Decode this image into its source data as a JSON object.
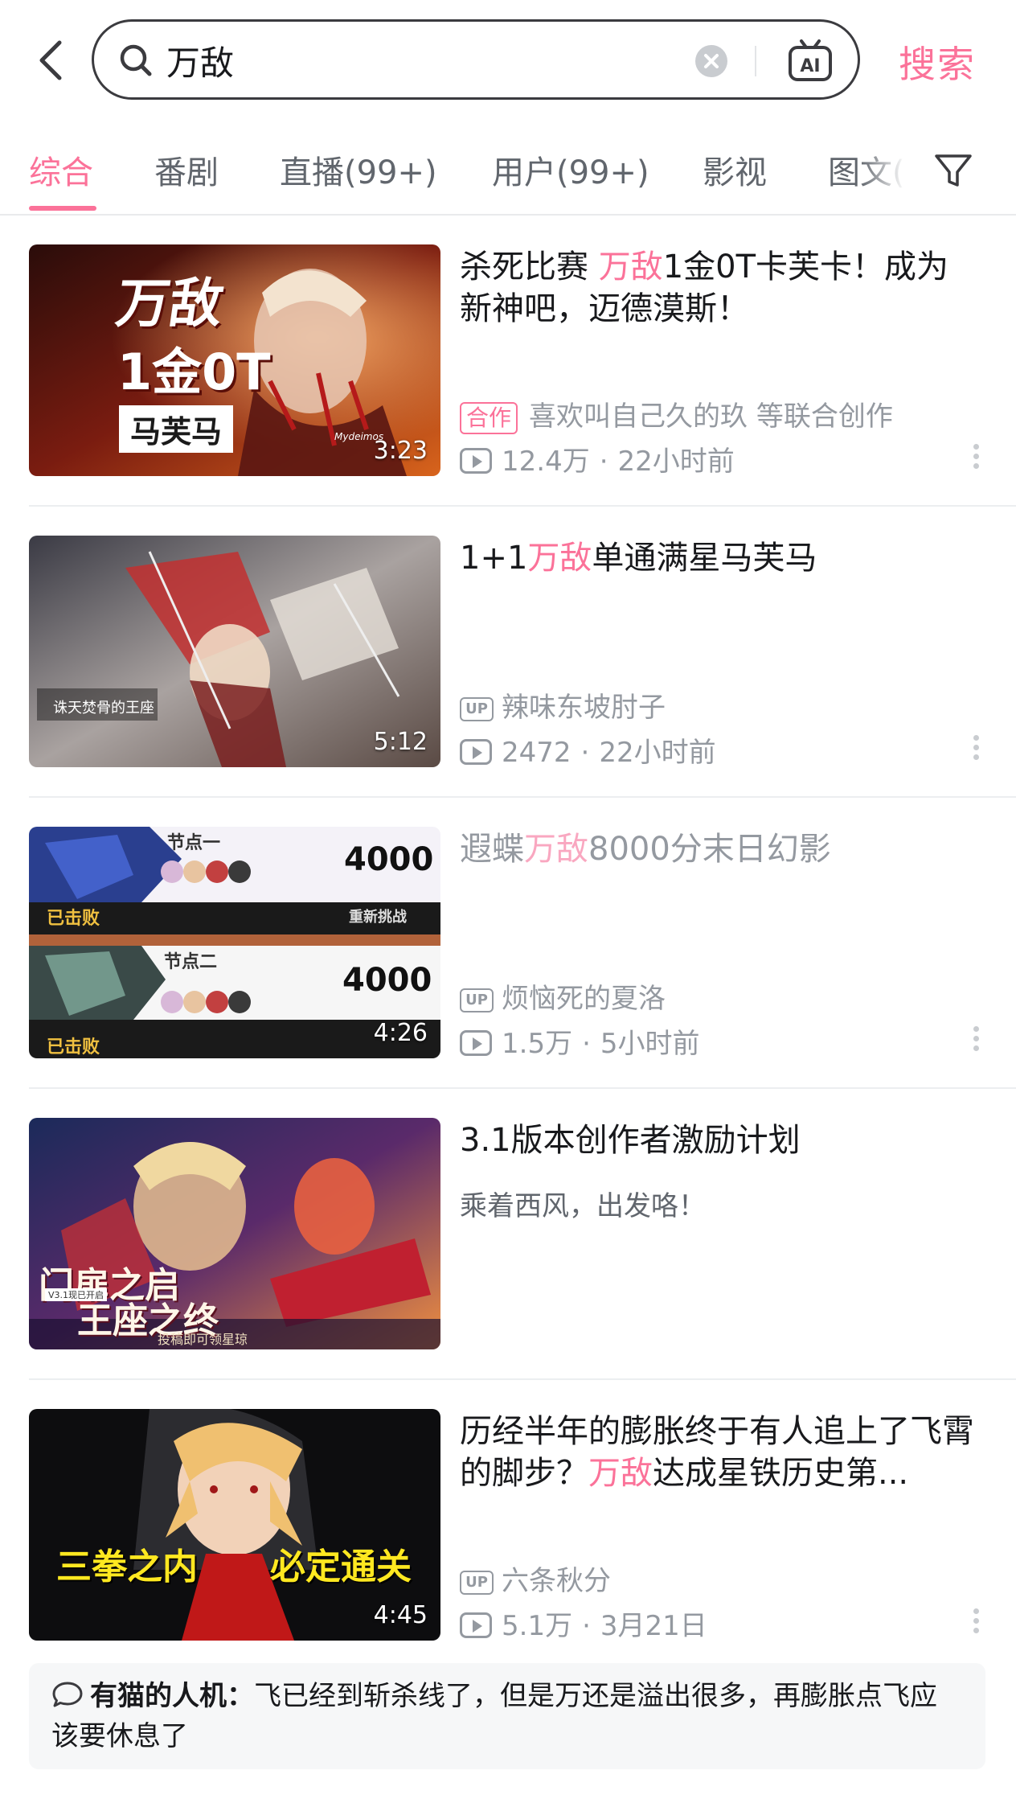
{
  "search": {
    "query": "万敌",
    "submit_label": "搜索",
    "ai_label": "AI"
  },
  "tabs": [
    {
      "label": "综合",
      "active": true
    },
    {
      "label": "番剧"
    },
    {
      "label": "直播(99+)"
    },
    {
      "label": "用户(99+)"
    },
    {
      "label": "影视"
    },
    {
      "label": "图文("
    }
  ],
  "results": [
    {
      "title_pre": "杀死比赛 ",
      "title_hl": "万敌",
      "title_post": "1金0T卡芙卡！成为新神吧，迈德漠斯！",
      "badge": "合作",
      "author": "喜欢叫自己久的玖 等联合创作",
      "views": "12.4万",
      "time": "22小时前",
      "duration": "3:23",
      "thumb_text": {
        "line1": "万敌",
        "line2": "1金0T",
        "line3": "马芙马",
        "sig": "Mydeimos"
      }
    },
    {
      "title_pre": "1+1",
      "title_hl": "万敌",
      "title_post": "单通满星马芙马",
      "badge": "UP",
      "author": "辣味东坡肘子",
      "views": "2472",
      "time": "22小时前",
      "duration": "5:12",
      "thumb_text": {
        "caption": "诛天焚骨的王座"
      }
    },
    {
      "title_pre": "遐蝶",
      "title_hl": "万敌",
      "title_post": "8000分末日幻影",
      "badge": "UP",
      "author": "烦恼死的夏洛",
      "views": "1.5万",
      "time": "5小时前",
      "duration": "4:26",
      "thumb_text": {
        "node1": "节点一",
        "node2": "节点二",
        "score1": "4000",
        "score2": "4000",
        "defeated": "已击败",
        "retry": "重新挑战"
      }
    },
    {
      "title": "3.1版本创作者激励计划",
      "subtitle": "乘着西风，出发咯！",
      "thumb_text": {
        "line1": "门扉之启",
        "line2": "王座之终",
        "tag": "V3.1现已开启",
        "bottom": "投稿即可领星琼"
      }
    },
    {
      "title_pre": "历经半年的膨胀终于有人追上了飞霄的脚步？",
      "title_hl": "万敌",
      "title_post": "达成星铁历史第...",
      "badge": "UP",
      "author": "六条秋分",
      "views": "5.1万",
      "time": "3月21日",
      "duration": "4:45",
      "thumb_text": {
        "left": "三拳之内",
        "right": "必定通关"
      }
    }
  ],
  "comment": {
    "user": "有猫的人机：",
    "text": "飞已经到斩杀线了，但是万还是溢出很多，再膨胀点飞应该要休息了"
  },
  "colors": {
    "accent": "#fb7299",
    "text_primary": "#18191c",
    "text_secondary": "#9499a0"
  }
}
